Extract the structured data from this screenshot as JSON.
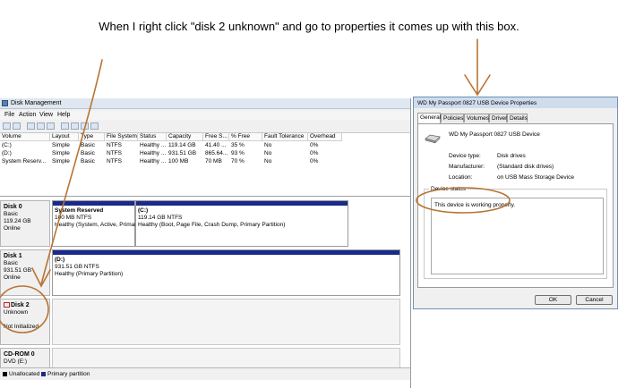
{
  "caption": "When I right click \"disk 2 unknown\" and go to properties it comes up with this box.",
  "dm": {
    "title": "Disk Management",
    "menu": [
      "File",
      "Action",
      "View",
      "Help"
    ],
    "columns": [
      "Volume",
      "Layout",
      "Type",
      "File System",
      "Status",
      "Capacity",
      "Free S...",
      "% Free",
      "Fault Tolerance",
      "Overhead"
    ],
    "rows": [
      [
        "(C:)",
        "Simple",
        "Basic",
        "NTFS",
        "Healthy ...",
        "119.14 GB",
        "41.40 ...",
        "35 %",
        "No",
        "0%"
      ],
      [
        "(D:)",
        "Simple",
        "Basic",
        "NTFS",
        "Healthy ...",
        "931.51 GB",
        "865.64...",
        "93 %",
        "No",
        "0%"
      ],
      [
        "System Reserv...",
        "Simple",
        "Basic",
        "NTFS",
        "Healthy ...",
        "100 MB",
        "70 MB",
        "70 %",
        "No",
        "0%"
      ]
    ],
    "disk0": {
      "name": "Disk 0",
      "type": "Basic",
      "size": "119.24 GB",
      "status": "Online",
      "p1": {
        "name": "System Reserved",
        "size": "100 MB NTFS",
        "status": "Healthy (System, Active, Primar"
      },
      "p2": {
        "name": "(C:)",
        "size": "119.14 GB NTFS",
        "status": "Healthy (Boot, Page File, Crash Dump, Primary Partition)"
      }
    },
    "disk1": {
      "name": "Disk 1",
      "type": "Basic",
      "size": "931.51 GB",
      "status": "Online",
      "p1": {
        "name": "(D:)",
        "size": "931.51 GB NTFS",
        "status": "Healthy (Primary Partition)"
      }
    },
    "disk2": {
      "name": "Disk 2",
      "type": "Unknown",
      "status": "Not Initialized"
    },
    "cdrom": {
      "name": "CD-ROM 0",
      "type": "DVD (E:)"
    },
    "legend": {
      "unallocated": "Unallocated",
      "primary": "Primary partition"
    }
  },
  "dialog": {
    "title": "WD My Passport 0827 USB Device Properties",
    "tabs": [
      "General",
      "Policies",
      "Volumes",
      "Driver",
      "Details"
    ],
    "device_name": "WD My Passport 0827 USB Device",
    "fields": [
      {
        "label": "Device type:",
        "value": "Disk drives"
      },
      {
        "label": "Manufacturer:",
        "value": "(Standard disk drives)"
      },
      {
        "label": "Location:",
        "value": "on USB Mass Storage Device"
      }
    ],
    "status_group": "Device status",
    "status_text": "This device is working properly.",
    "ok": "OK",
    "cancel": "Cancel"
  },
  "colors": {
    "annotation": "#b87333",
    "partition_band": "#1a2a8a"
  }
}
